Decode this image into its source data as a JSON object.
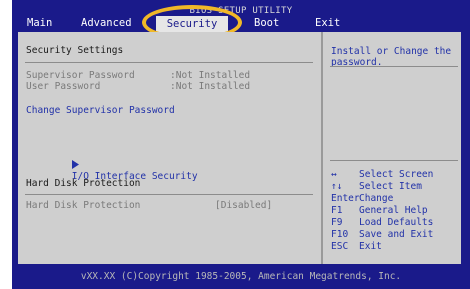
{
  "header": {
    "title": "BIOS SETUP UTILITY",
    "tabs": [
      "Main",
      "Advanced",
      "Security",
      "Boot",
      "Exit"
    ]
  },
  "left": {
    "section_title": "Security Settings",
    "supervisor_label": "Supervisor Password",
    "supervisor_value": ":Not Installed",
    "user_label": "User Password",
    "user_value": ":Not Installed",
    "change_supervisor": "Change Supervisor Password",
    "io_security": "I/O Interface Security",
    "hdd_section": "Hard Disk Protection",
    "hdd_label": "Hard Disk Protection",
    "hdd_value": "[Disabled]"
  },
  "help": {
    "text": "Install or Change the password.",
    "keys": [
      {
        "key": "↔",
        "desc": "Select Screen"
      },
      {
        "key": "↑↓",
        "desc": "Select Item"
      },
      {
        "key": "Enter",
        "desc": "Change"
      },
      {
        "key": "F1",
        "desc": "General Help"
      },
      {
        "key": "F9",
        "desc": "Load Defaults"
      },
      {
        "key": "F10",
        "desc": "Save and Exit"
      },
      {
        "key": "ESC",
        "desc": "Exit"
      }
    ]
  },
  "footer": {
    "copyright": "vXX.XX (C)Copyright 1985-2005, American Megatrends, Inc."
  },
  "colors": {
    "background": "#1a1a8a",
    "panel": "#cfcfcf",
    "accent_highlight": "#f0b828",
    "item_text": "#2232a8"
  }
}
